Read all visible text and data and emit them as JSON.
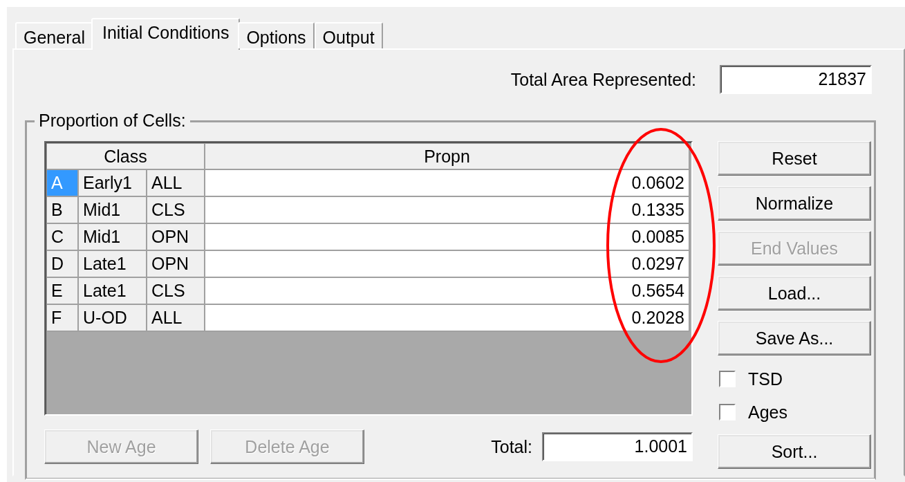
{
  "tabs": [
    {
      "label": "General",
      "selected": false
    },
    {
      "label": "Initial Conditions",
      "selected": true
    },
    {
      "label": "Options",
      "selected": false
    },
    {
      "label": "Output",
      "selected": false
    }
  ],
  "total_area": {
    "label": "Total Area Represented:",
    "value": "21837"
  },
  "proportion_group": {
    "label": "Proportion of Cells:",
    "table": {
      "columns": [
        "Class",
        "Propn"
      ],
      "rows": [
        {
          "letter": "A",
          "stage": "Early1",
          "cover": "ALL",
          "propn": "0.0602",
          "selected": true
        },
        {
          "letter": "B",
          "stage": "Mid1",
          "cover": "CLS",
          "propn": "0.1335",
          "selected": false
        },
        {
          "letter": "C",
          "stage": "Mid1",
          "cover": "OPN",
          "propn": "0.0085",
          "selected": false
        },
        {
          "letter": "D",
          "stage": "Late1",
          "cover": "OPN",
          "propn": "0.0297",
          "selected": false
        },
        {
          "letter": "E",
          "stage": "Late1",
          "cover": "CLS",
          "propn": "0.5654",
          "selected": false
        },
        {
          "letter": "F",
          "stage": "U-OD",
          "cover": "ALL",
          "propn": "0.2028",
          "selected": false
        }
      ]
    },
    "side_buttons": [
      {
        "label": "Reset",
        "disabled": false
      },
      {
        "label": "Normalize",
        "disabled": false
      },
      {
        "label": "End Values",
        "disabled": true
      },
      {
        "label": "Load...",
        "disabled": false
      },
      {
        "label": "Save As...",
        "disabled": false
      }
    ],
    "checkboxes": [
      {
        "label": "TSD",
        "checked": false
      },
      {
        "label": "Ages",
        "checked": false
      }
    ],
    "sort_button": {
      "label": "Sort...",
      "disabled": false
    },
    "bottom_buttons": [
      {
        "label": "New Age",
        "disabled": true
      },
      {
        "label": "Delete Age",
        "disabled": true
      }
    ],
    "total": {
      "label": "Total:",
      "value": "1.0001"
    }
  },
  "annotation": {
    "kind": "ellipse"
  }
}
